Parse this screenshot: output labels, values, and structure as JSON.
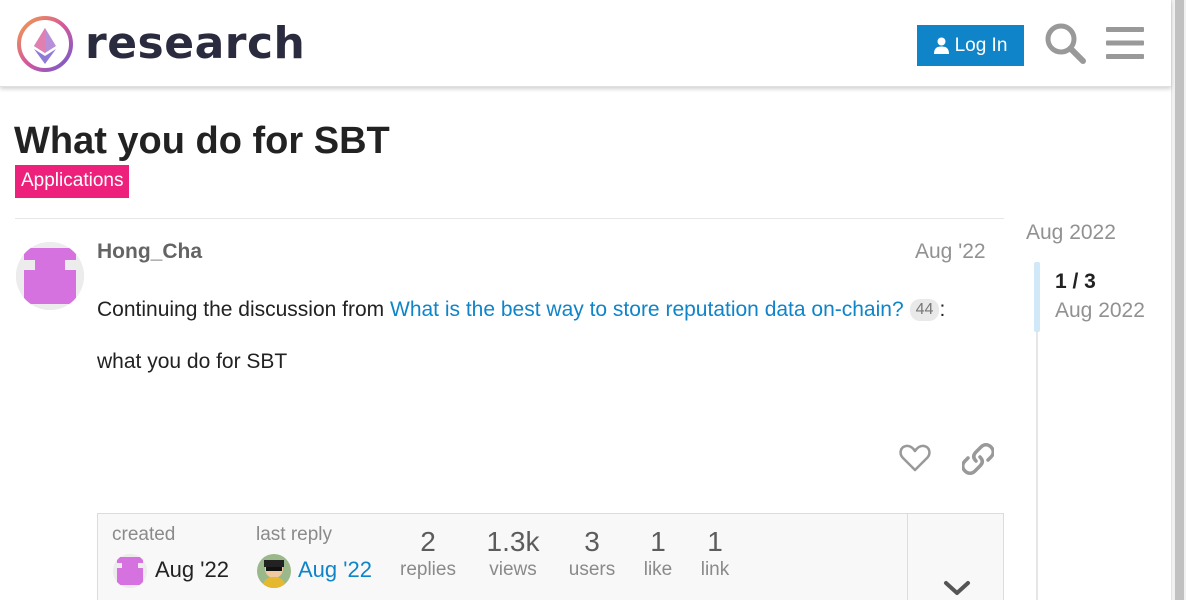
{
  "header": {
    "site_name": "research",
    "login_label": "Log In"
  },
  "topic": {
    "title": "What you do for SBT",
    "category": "Applications"
  },
  "post": {
    "author": "Hong_Cha",
    "date": "Aug '22",
    "intro_text": "Continuing the discussion from",
    "link_text": "What is the best way to store reputation data on-chain?",
    "link_count": "44",
    "link_suffix": ":",
    "body": "what you do for SBT"
  },
  "topic_map": {
    "created_label": "created",
    "created_date": "Aug '22",
    "last_reply_label": "last reply",
    "last_reply_date": "Aug '22",
    "stats": [
      {
        "num": "2",
        "label": "replies"
      },
      {
        "num": "1.3k",
        "label": "views"
      },
      {
        "num": "3",
        "label": "users"
      },
      {
        "num": "1",
        "label": "like"
      },
      {
        "num": "1",
        "label": "link"
      }
    ]
  },
  "timeline": {
    "start_date": "Aug 2022",
    "position": "1 / 3",
    "current_date": "Aug 2022"
  },
  "colors": {
    "accent": "#0f84c9",
    "category": "#ed207b",
    "avatar_purple": "#d672e0"
  },
  "icons": [
    "logo-icon",
    "user-icon",
    "search-icon",
    "hamburger-menu-icon",
    "heart-icon",
    "link-icon",
    "chevron-down-icon"
  ]
}
